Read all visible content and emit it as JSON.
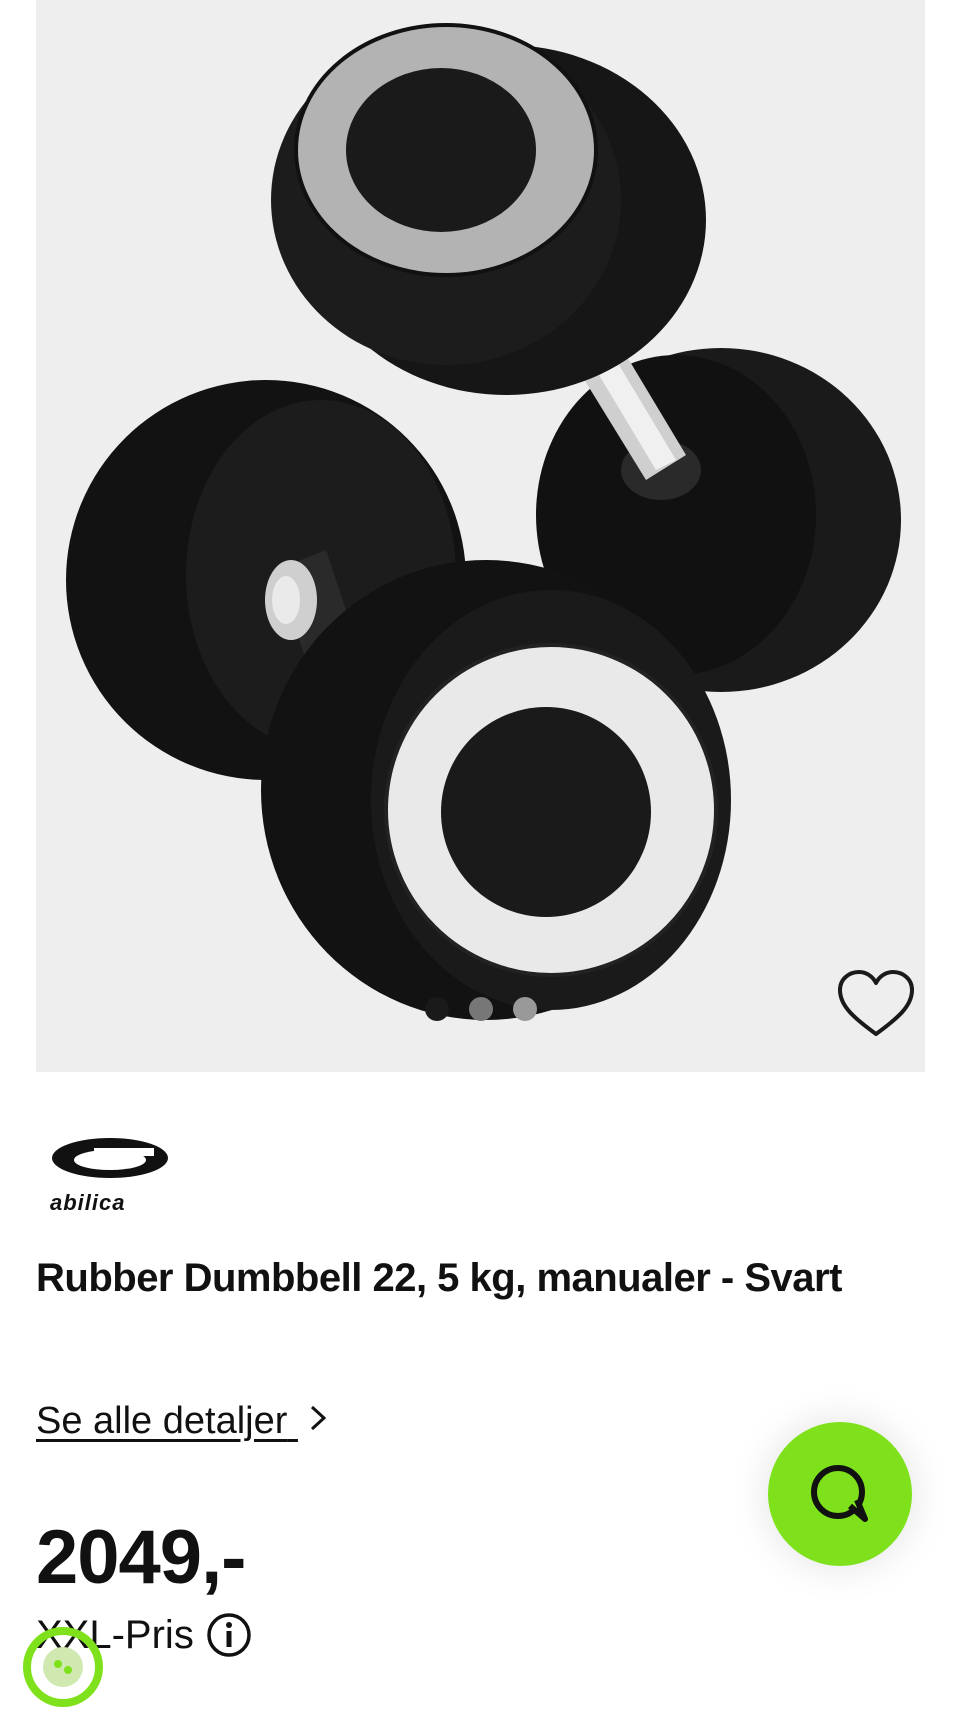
{
  "product": {
    "brand": "abilica",
    "title": "Rubber Dumbbell 22, 5 kg, manualer - Svart",
    "details_link": "Se alle detaljer",
    "price": "2049,-",
    "price_label": "XXL-Pris"
  },
  "carousel": {
    "dots": 3,
    "active_index": 0
  },
  "icons": {
    "wishlist": "heart-icon",
    "chevron": "chevron-right-icon",
    "info": "info-icon",
    "chat": "chat-bubble-icon",
    "eco": "eco-badge-icon"
  },
  "colors": {
    "chat_button": "#7ee11b",
    "image_bg": "#eeeeee",
    "text": "#111111"
  }
}
